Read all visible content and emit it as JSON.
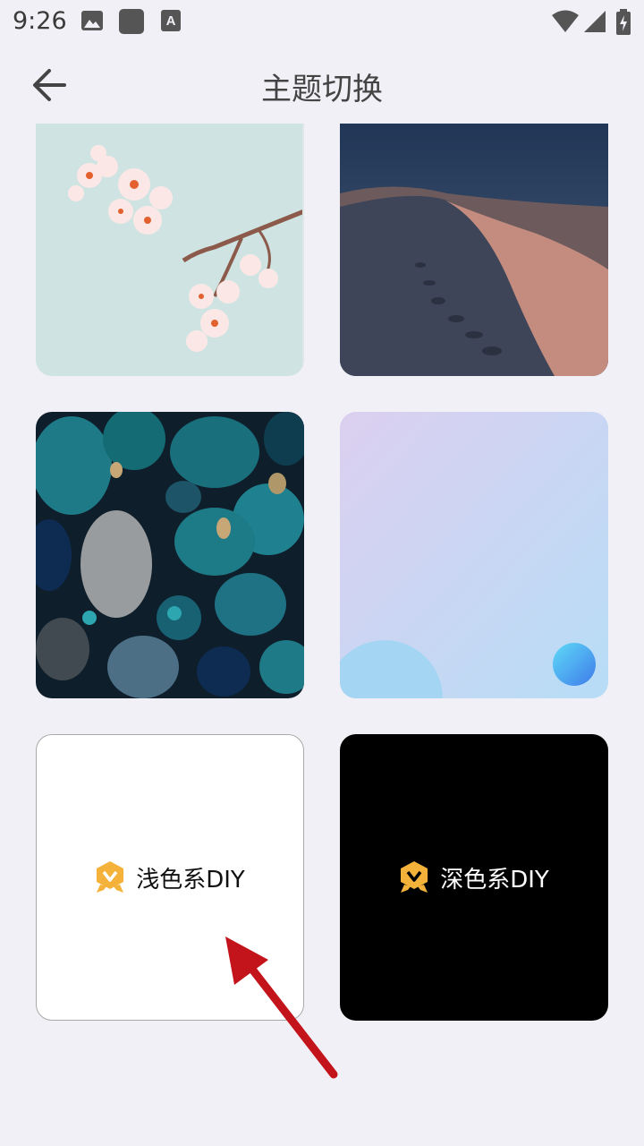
{
  "status_bar": {
    "time": "9:26",
    "icons": [
      "image-icon",
      "square-app-icon",
      "font-a-icon",
      "wifi-icon",
      "signal-icon",
      "battery-charging-icon"
    ]
  },
  "header": {
    "back_icon": "arrow-left-icon",
    "title": "主题切换"
  },
  "themes": [
    {
      "kind": "image",
      "subject": "cherry-blossom-branch"
    },
    {
      "kind": "image",
      "subject": "desert-dunes-at-dusk"
    },
    {
      "kind": "image",
      "subject": "teal-pebbles"
    },
    {
      "kind": "image",
      "subject": "lavender-blue-gradient"
    },
    {
      "kind": "diy",
      "label": "浅色系DIY",
      "icon": "vip-badge-icon",
      "background": "#FFFFFF",
      "text_color": "#111111"
    },
    {
      "kind": "diy",
      "label": "深色系DIY",
      "icon": "vip-badge-icon",
      "background": "#000000",
      "text_color": "#FFFFFF"
    }
  ],
  "colors": {
    "page_background": "#F1F0F6",
    "badge_gold": "#F4B23A",
    "annotation_arrow": "#C4141B"
  }
}
